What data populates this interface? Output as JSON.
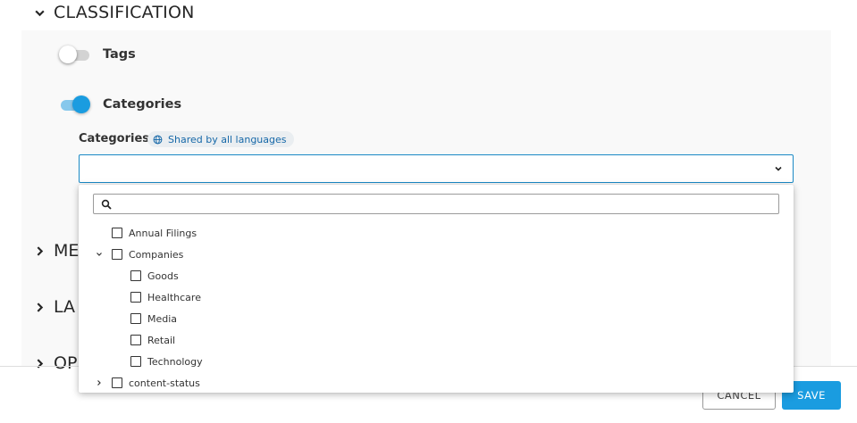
{
  "classification": {
    "title": "CLASSIFICATION",
    "toggles": [
      {
        "label": "Tags",
        "on": false
      },
      {
        "label": "Categories",
        "on": true
      }
    ],
    "field": {
      "label": "Categories",
      "badge": "Shared by all languages",
      "value": ""
    }
  },
  "collapsed_sections": [
    {
      "title_visible": "ME"
    },
    {
      "title_visible": "LA"
    },
    {
      "title_visible": "OP"
    }
  ],
  "dropdown": {
    "search_value": "",
    "items": [
      {
        "label": "Annual Filings",
        "expander": "none",
        "checked": false
      },
      {
        "label": "Companies",
        "expander": "expanded",
        "checked": false
      },
      {
        "label": "Goods",
        "expander": "none",
        "checked": false
      },
      {
        "label": "Healthcare",
        "expander": "none",
        "checked": false
      },
      {
        "label": "Media",
        "expander": "none",
        "checked": false
      },
      {
        "label": "Retail",
        "expander": "none",
        "checked": false
      },
      {
        "label": "Technology",
        "expander": "none",
        "checked": false
      },
      {
        "label": "content-status",
        "expander": "collapsed",
        "checked": false
      }
    ]
  },
  "footer": {
    "cancel_label": "CANCEL",
    "save_label": "SAVE"
  },
  "colors": {
    "accent": "#1a9ce0",
    "badge_text": "#1668a8",
    "panel_bg": "#f9f9f9"
  },
  "icons": {
    "section_expanded": "chevron-down-icon",
    "section_collapsed": "chevron-right-icon",
    "badge": "globe-icon",
    "select": "chevron-down-icon",
    "search": "search-icon"
  }
}
